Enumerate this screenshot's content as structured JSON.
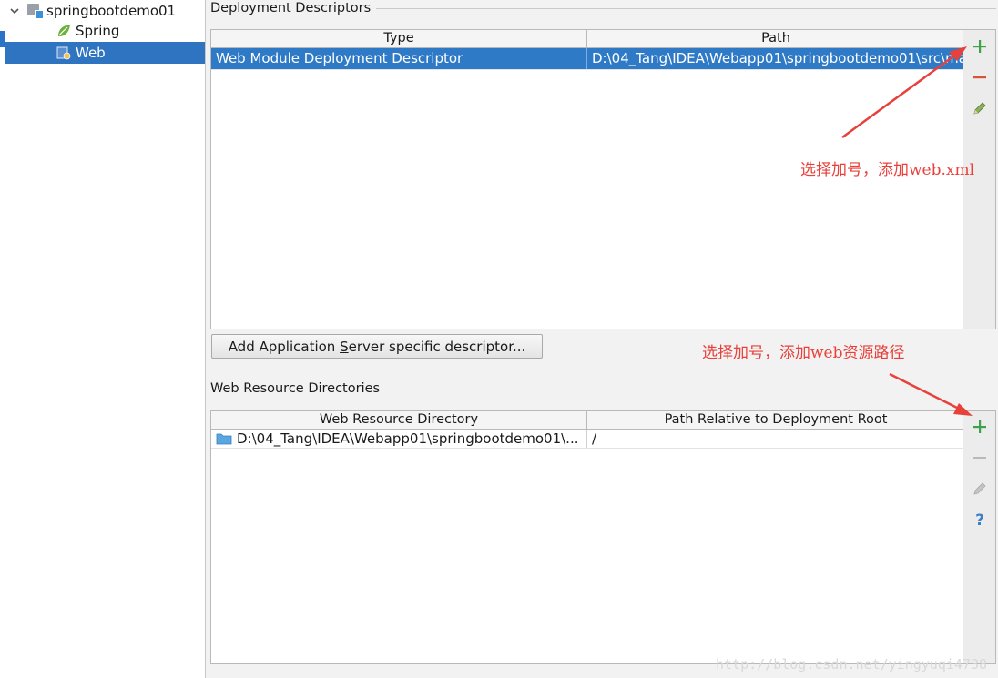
{
  "tree": {
    "root_label": "springbootdemo01",
    "spring_label": "Spring",
    "web_label": "Web"
  },
  "deployment": {
    "section_title": "Deployment Descriptors",
    "columns": [
      "Type",
      "Path"
    ],
    "rows": [
      {
        "type": "Web Module Deployment Descriptor",
        "path": "D:\\04_Tang\\IDEA\\Webapp01\\springbootdemo01\\src\\ma"
      }
    ],
    "add_server_button_prefix": "Add Application ",
    "add_server_button_mnemonic": "S",
    "add_server_button_suffix": "erver specific descriptor..."
  },
  "resources": {
    "section_title": "Web Resource Directories",
    "columns": [
      "Web Resource Directory",
      "Path Relative to Deployment Root"
    ],
    "rows": [
      {
        "directory": "D:\\04_Tang\\IDEA\\Webapp01\\springbootdemo01\\...",
        "relative_path": "/"
      }
    ]
  },
  "annotations": {
    "top": "选择加号，添加web.xml",
    "bottom": "选择加号，添加web资源路径"
  },
  "watermark": "http://blog.csdn.net/yingyuqi4738",
  "icons": {
    "add": "plus-icon",
    "remove": "minus-icon",
    "edit": "pencil-icon",
    "help": "question-icon",
    "folder": "folder-icon",
    "spring": "spring-leaf-icon",
    "web": "web-facet-icon",
    "module": "module-icon"
  },
  "colors": {
    "selection": "#2f7ac6",
    "add_green": "#3fa24a",
    "remove_red": "#d9533a",
    "annotation_red": "#e8403a"
  }
}
